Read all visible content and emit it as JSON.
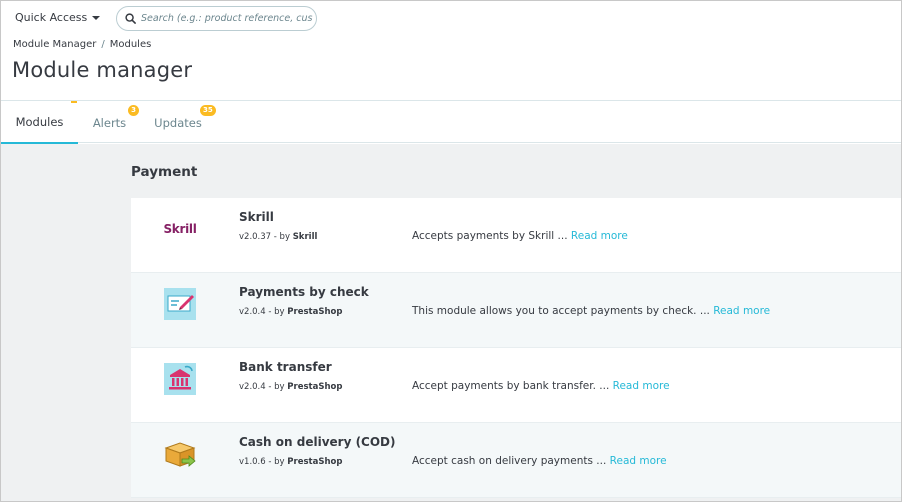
{
  "header": {
    "quick_access_label": "Quick Access",
    "search_placeholder": "Search (e.g.: product reference, custome"
  },
  "breadcrumb": {
    "items": [
      "Module Manager",
      "Modules"
    ],
    "separator": "/"
  },
  "page_title": "Module manager",
  "tabs": [
    {
      "label": "Modules",
      "active": true,
      "badge": ""
    },
    {
      "label": "Alerts",
      "active": false,
      "badge": "3"
    },
    {
      "label": "Updates",
      "active": false,
      "badge": "35"
    }
  ],
  "colors": {
    "accent": "#25b9d7",
    "badge": "#fbbb22",
    "skrill": "#862165",
    "check_icon_bg": "#a8e1ee",
    "check_icon_pink": "#d9336f"
  },
  "category": {
    "title": "Payment",
    "modules": [
      {
        "name": "Skrill",
        "version": "v2.0.37",
        "by_label": "- by",
        "author": "Skrill",
        "description": "Accepts payments by Skrill ...",
        "read_more": "Read more",
        "icon": "skrill-logo",
        "logo_text": "Skrill"
      },
      {
        "name": "Payments by check",
        "version": "v2.0.4",
        "by_label": "- by",
        "author": "PrestaShop",
        "description": "This module allows you to accept payments by check. ...",
        "read_more": "Read more",
        "icon": "check-icon"
      },
      {
        "name": "Bank transfer",
        "version": "v2.0.4",
        "by_label": "- by",
        "author": "PrestaShop",
        "description": "Accept payments by bank transfer. ...",
        "read_more": "Read more",
        "icon": "bank-icon"
      },
      {
        "name": "Cash on delivery (COD)",
        "version": "v1.0.6",
        "by_label": "- by",
        "author": "PrestaShop",
        "description": "Accept cash on delivery payments ...",
        "read_more": "Read more",
        "icon": "box-icon"
      }
    ]
  }
}
